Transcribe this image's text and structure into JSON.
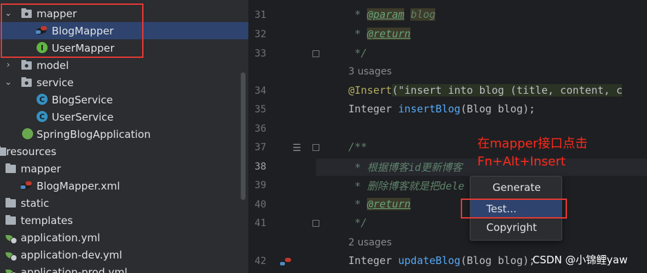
{
  "sidebar": {
    "items": [
      {
        "label": "mapper",
        "type": "package"
      },
      {
        "label": "BlogMapper",
        "type": "mybatis"
      },
      {
        "label": "UserMapper",
        "type": "interface",
        "icon_letter": "I"
      },
      {
        "label": "model",
        "type": "package"
      },
      {
        "label": "service",
        "type": "package"
      },
      {
        "label": "BlogService",
        "type": "class",
        "icon_letter": "C"
      },
      {
        "label": "UserService",
        "type": "class",
        "icon_letter": "C"
      },
      {
        "label": "SpringBlogApplication",
        "type": "spring"
      },
      {
        "label": "resources",
        "type": "folder"
      },
      {
        "label": "mapper",
        "type": "folder"
      },
      {
        "label": "BlogMapper.xml",
        "type": "mybatis-xml"
      },
      {
        "label": "static",
        "type": "folder"
      },
      {
        "label": "templates",
        "type": "folder"
      },
      {
        "label": "application.yml",
        "type": "yml"
      },
      {
        "label": "application-dev.yml",
        "type": "yml"
      },
      {
        "label": "application-prod.yml",
        "type": "yml"
      }
    ]
  },
  "editor": {
    "line_numbers": [
      "31",
      "32",
      "33",
      "34",
      "35",
      "36",
      "37",
      "38",
      "39",
      "40",
      "41",
      "42"
    ],
    "usages_1": "3 usages",
    "usages_2": "2 usages",
    "lines": {
      "l31_prefix": " * ",
      "l31_tag": "@param",
      "l31_arg": "blog",
      "l32_prefix": " * ",
      "l32_tag": "@return",
      "l33": " */",
      "l34_ann": "@Insert",
      "l34_open": "(\"",
      "l34_str": "insert into blog (title, content, c",
      "l35_type": "Integer ",
      "l35_fn": "insertBlog",
      "l35_rest": "(Blog blog);",
      "l37": "/**",
      "l38": " * 根据博客id更新博客",
      "l39": " * 删除博客就是把dele",
      "l40_prefix": " * ",
      "l40_tag": "@return",
      "l41": " */",
      "l42_type": "Integer ",
      "l42_fn": "updateBlog",
      "l42_rest": "(Blog blog);"
    }
  },
  "annotation": {
    "line1": "在mapper接口点击",
    "line2": "Fn+Alt+Insert",
    "color": "#ff2a1a"
  },
  "context_menu": {
    "items": [
      "Generate",
      "Test...",
      "Copyright"
    ],
    "selected": "Test..."
  },
  "watermark": "CSDN @小锦鲤yaw",
  "colors": {
    "selection": "#2e436e",
    "highlight_box": "#e53935",
    "editor_bg": "#1e1f22",
    "panel_bg": "#2b2d30"
  }
}
